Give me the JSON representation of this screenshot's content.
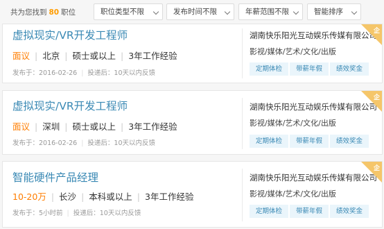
{
  "results": {
    "prefix": "共为您找到",
    "count": "80",
    "suffix": "职位"
  },
  "filters": [
    {
      "label": "职位类型不限"
    },
    {
      "label": "发布时间不限"
    },
    {
      "label": "年薪范围不限"
    },
    {
      "label": "智能排序"
    }
  ],
  "jobs": [
    {
      "title": "虚拟现实/VR开发工程师",
      "salary": "面议",
      "city": "北京",
      "education": "硕士或以上",
      "experience": "3年工作经验",
      "published": "发布于：2016-02-26",
      "feedback": "投递后：10天以内反馈",
      "company": "湖南快乐阳光互动娱乐传媒有限公司",
      "industry": "影视/媒体/艺术/文化/出版",
      "tags": [
        "定期体检",
        "带薪年假",
        "绩效奖金"
      ],
      "badge": "企"
    },
    {
      "title": "虚拟现实/VR开发工程师",
      "salary": "面议",
      "city": "深圳",
      "education": "硕士或以上",
      "experience": "3年工作经验",
      "published": "发布于：2016-02-26",
      "feedback": "投递后：10天以内反馈",
      "company": "湖南快乐阳光互动娱乐传媒有限公司",
      "industry": "影视/媒体/艺术/文化/出版",
      "tags": [
        "定期体检",
        "带薪年假",
        "绩效奖金"
      ],
      "badge": "企"
    },
    {
      "title": "智能硬件产品经理",
      "salary": "10-20万",
      "city": "长沙",
      "education": "本科或以上",
      "experience": "3年工作经验",
      "published": "发布于：5小时前",
      "feedback": "投递后：10天以内反馈",
      "company": "湖南快乐阳光互动娱乐传媒有限公司",
      "industry": "影视/媒体/艺术/文化/出版",
      "tags": [
        "定期体检",
        "带薪年假",
        "绩效奖金"
      ],
      "badge": "企"
    }
  ],
  "colors": {
    "accent_orange": "#ff7d00",
    "count_orange": "#ff9c00",
    "title_blue": "#3a89b4",
    "tag_bg": "#eaf5fb",
    "badge_gold": "#f5c66a"
  },
  "icons": {
    "dropdown": "chevron-down-icon"
  }
}
